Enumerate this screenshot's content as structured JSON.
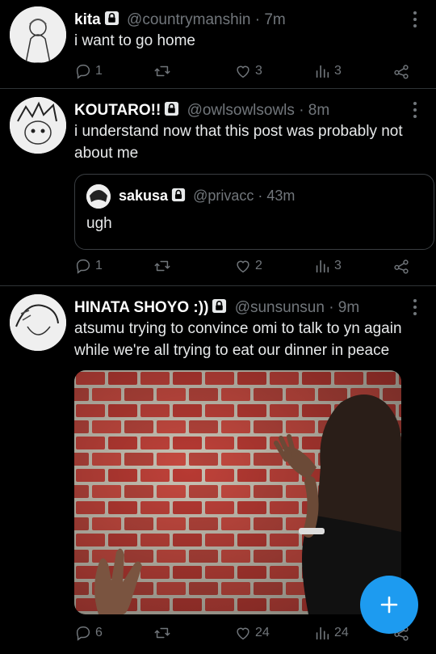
{
  "tweets": [
    {
      "name": "kita",
      "handle": "@countrymanshin",
      "time": "· 7m",
      "text": "i want to go home",
      "replies": "1",
      "retweets": "",
      "likes": "3",
      "views": "3"
    },
    {
      "name": "KOUTARO!!",
      "handle": "@owlsowlsowls",
      "time": "· 8m",
      "text": "i understand now that this post was probably not about me",
      "quote": {
        "name": "sakusa",
        "handle": "@privacc",
        "time": "· 43m",
        "text": "ugh"
      },
      "replies": "1",
      "retweets": "",
      "likes": "2",
      "views": "3"
    },
    {
      "name": "HINATA SHOYO :))",
      "handle": "@sunsunsun",
      "time": "· 9m",
      "text": "atsumu trying to convince omi to talk to yn again while we're all trying to eat our dinner in peace",
      "media": "photo-brick-wall-meme",
      "replies": "6",
      "retweets": "",
      "likes": "24",
      "views": "24"
    }
  ],
  "icons": {
    "reply": "reply-icon",
    "retweet": "retweet-icon",
    "like": "heart-icon",
    "views": "views-icon",
    "share": "share-icon",
    "compose": "plus-icon",
    "lock": "lock-icon",
    "more": "more-dots-icon"
  },
  "colors": {
    "background": "#000000",
    "text": "#e7e9ea",
    "muted": "#71767b",
    "accent": "#1d9bf0",
    "divider": "#2f3336"
  }
}
